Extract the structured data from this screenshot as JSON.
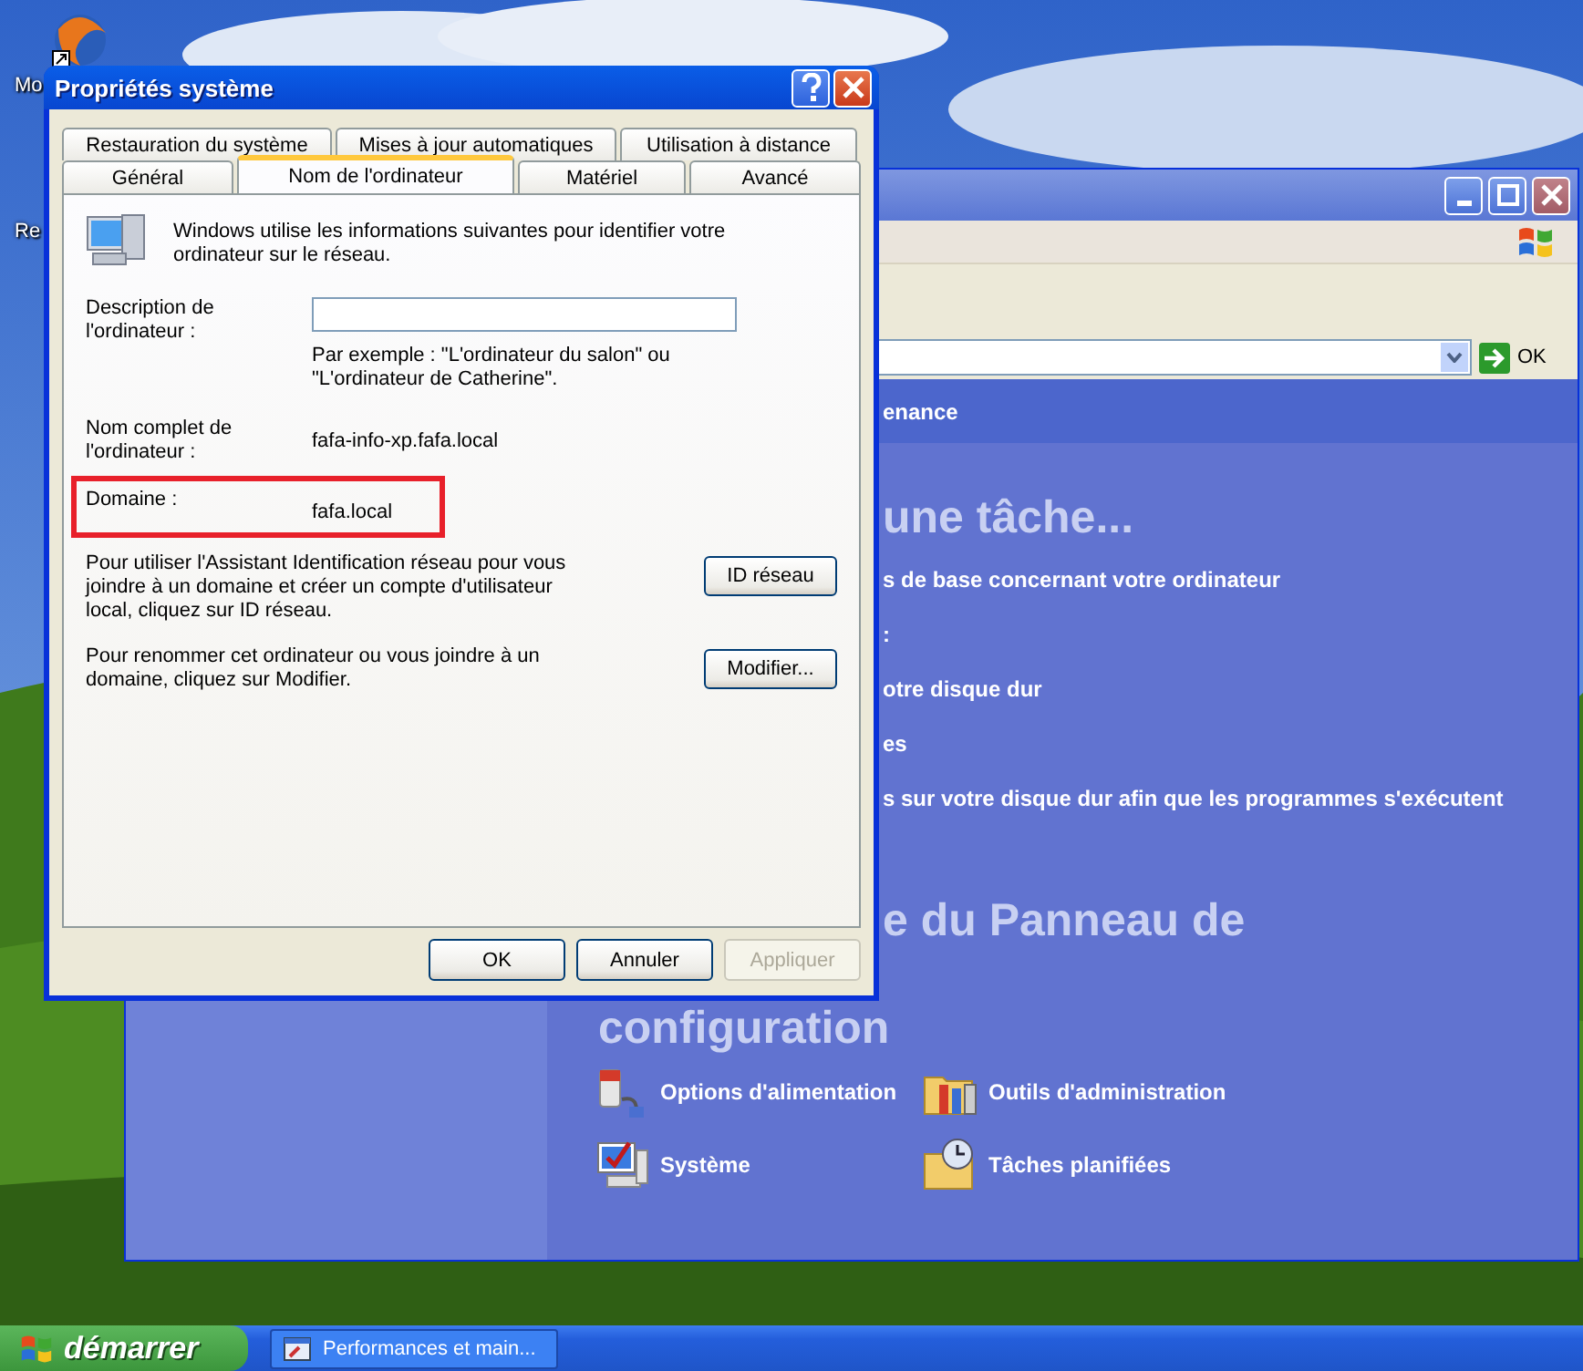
{
  "desktop": {
    "icons": [
      {
        "label": "Mo"
      },
      {
        "label": "Re"
      }
    ]
  },
  "background_window": {
    "address_go": "OK",
    "header": "enance",
    "heading": "une tâche...",
    "tasks": [
      "s de base concernant votre ordinateur",
      ":",
      "otre disque dur",
      "es",
      "s sur votre disque dur afin que les programmes s'exécutent"
    ],
    "section_heading": "e du Panneau de",
    "section_heading_2": "configuration",
    "icons": [
      {
        "label": "Options d'alimentation"
      },
      {
        "label": "Outils d'administration"
      },
      {
        "label": "Système"
      },
      {
        "label": "Tâches planifiées"
      }
    ]
  },
  "dialog": {
    "title": "Propriétés système",
    "tabs_row_1": [
      {
        "label": "Restauration du système",
        "selected": false
      },
      {
        "label": "Mises à jour automatiques",
        "selected": false
      },
      {
        "label": "Utilisation à distance",
        "selected": false
      }
    ],
    "tabs_row_2": [
      {
        "label": "Général",
        "selected": false
      },
      {
        "label": "Nom de l'ordinateur",
        "selected": true
      },
      {
        "label": "Matériel",
        "selected": false
      },
      {
        "label": "Avancé",
        "selected": false
      }
    ],
    "intro": "Windows utilise les informations suivantes pour identifier votre ordinateur sur le réseau.",
    "fields": [
      {
        "kind": "input",
        "label": "Description de l'ordinateur :",
        "note": "Par exemple : \"L'ordinateur du salon\" ou \"L'ordinateur de Catherine\".",
        "highlighted": false
      },
      {
        "kind": "text",
        "label": "Nom complet de l'ordinateur :",
        "value": "fafa-info-xp.fafa.local",
        "highlighted": false
      },
      {
        "kind": "text",
        "label": "Domaine :",
        "value": "fafa.local",
        "highlighted": true
      }
    ],
    "actions": [
      {
        "text": "Pour utiliser l'Assistant Identification réseau pour vous joindre à un domaine et créer un compte d'utilisateur local, cliquez sur ID réseau.",
        "button": "ID réseau"
      },
      {
        "text": "Pour renommer cet ordinateur ou vous joindre à un domaine, cliquez sur Modifier.",
        "button": "Modifier..."
      }
    ],
    "buttons": [
      {
        "label": "OK",
        "disabled": false
      },
      {
        "label": "Annuler",
        "disabled": false
      },
      {
        "label": "Appliquer",
        "disabled": true
      }
    ]
  },
  "taskbar": {
    "start": "démarrer",
    "tasks": [
      {
        "label": "Performances et main..."
      }
    ]
  }
}
